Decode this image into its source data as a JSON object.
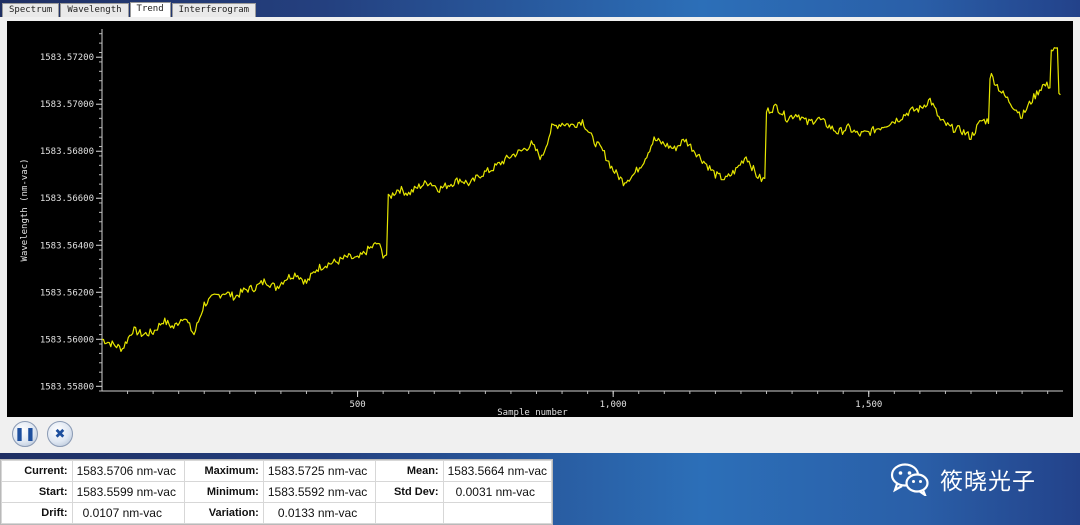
{
  "tabs": [
    {
      "label": "Spectrum",
      "active": false
    },
    {
      "label": "Wavelength",
      "active": false
    },
    {
      "label": "Trend",
      "active": true
    },
    {
      "label": "Interferogram",
      "active": false
    }
  ],
  "chart_data": {
    "type": "line",
    "xlabel": "Sample number",
    "ylabel": "Wavelength (nm-vac)",
    "xlim": [
      0,
      1880
    ],
    "ylim": [
      1583.5578,
      1583.5732
    ],
    "x_ticks": [
      500,
      1000,
      1500
    ],
    "x_tick_labels": [
      "500",
      "1,000",
      "1,500"
    ],
    "y_ticks": [
      1583.558,
      1583.56,
      1583.562,
      1583.564,
      1583.566,
      1583.568,
      1583.57,
      1583.572
    ],
    "y_tick_labels": [
      "1583.55800",
      "1583.56000",
      "1583.56200",
      "1583.56400",
      "1583.56600",
      "1583.56800",
      "1583.57000",
      "1583.57200"
    ],
    "line_color": "#e6e600",
    "grid": false,
    "series": [
      {
        "x": [
          0,
          20,
          40,
          60,
          80,
          100,
          120,
          140,
          160,
          180,
          200,
          220,
          240,
          260,
          280,
          300,
          320,
          340,
          360,
          380,
          400,
          420,
          440,
          460,
          480,
          500,
          520,
          540,
          550,
          560,
          580,
          600,
          620,
          640,
          660,
          680,
          700,
          720,
          740,
          760,
          780,
          800,
          820,
          840,
          860,
          880,
          900,
          920,
          940,
          960,
          980,
          1000,
          1020,
          1040,
          1060,
          1080,
          1100,
          1120,
          1140,
          1160,
          1180,
          1200,
          1220,
          1240,
          1260,
          1280,
          1290,
          1300,
          1320,
          1340,
          1360,
          1380,
          1400,
          1420,
          1440,
          1460,
          1480,
          1500,
          1520,
          1540,
          1560,
          1580,
          1600,
          1620,
          1640,
          1660,
          1680,
          1700,
          1720,
          1740,
          1760,
          1780,
          1800,
          1820,
          1840,
          1860,
          1875
        ],
        "values": [
          1583.56,
          1583.5598,
          1583.5596,
          1583.5604,
          1583.5602,
          1583.5603,
          1583.5608,
          1583.5605,
          1583.561,
          1583.5602,
          1583.5615,
          1583.5618,
          1583.562,
          1583.5618,
          1583.5621,
          1583.5622,
          1583.5625,
          1583.5622,
          1583.5626,
          1583.5628,
          1583.5624,
          1583.563,
          1583.5632,
          1583.5633,
          1583.5635,
          1583.5634,
          1583.5638,
          1583.5641,
          1583.5636,
          1583.566,
          1583.5664,
          1583.5662,
          1583.5665,
          1583.5667,
          1583.5664,
          1583.5666,
          1583.5668,
          1583.5666,
          1583.567,
          1583.5672,
          1583.5675,
          1583.5678,
          1583.568,
          1583.5683,
          1583.5677,
          1583.569,
          1583.5692,
          1583.5691,
          1583.5693,
          1583.5685,
          1583.568,
          1583.5672,
          1583.5667,
          1583.567,
          1583.5676,
          1583.5685,
          1583.5683,
          1583.5681,
          1583.5685,
          1583.568,
          1583.5675,
          1583.567,
          1583.5668,
          1583.5672,
          1583.5678,
          1583.567,
          1583.5668,
          1583.5697,
          1583.5699,
          1583.5694,
          1583.5696,
          1583.5692,
          1583.5694,
          1583.5691,
          1583.5688,
          1583.569,
          1583.5687,
          1583.5688,
          1583.569,
          1583.5692,
          1583.5694,
          1583.5697,
          1583.5698,
          1583.5702,
          1583.5693,
          1583.569,
          1583.5689,
          1583.5686,
          1583.5693,
          1583.5712,
          1583.5705,
          1583.57,
          1583.5695,
          1583.5702,
          1583.5708,
          1583.5723,
          1583.5704
        ]
      }
    ]
  },
  "controls": {
    "pause_icon": "pause-icon",
    "stop_icon": "stop-x-icon"
  },
  "stats": {
    "current_label": "Current:",
    "current_value": "1583.5706 nm-vac",
    "maximum_label": "Maximum:",
    "maximum_value": "1583.5725 nm-vac",
    "mean_label": "Mean:",
    "mean_value": "1583.5664 nm-vac",
    "start_label": "Start:",
    "start_value": "1583.5599 nm-vac",
    "minimum_label": "Minimum:",
    "minimum_value": "1583.5592 nm-vac",
    "stddev_label": "Std Dev:",
    "stddev_value": "0.0031 nm-vac",
    "drift_label": "Drift:",
    "drift_value": "0.0107 nm-vac",
    "variation_label": "Variation:",
    "variation_value": "0.0133 nm-vac"
  },
  "watermark": {
    "name": "筱晓光子",
    "icon": "wechat-icon"
  }
}
